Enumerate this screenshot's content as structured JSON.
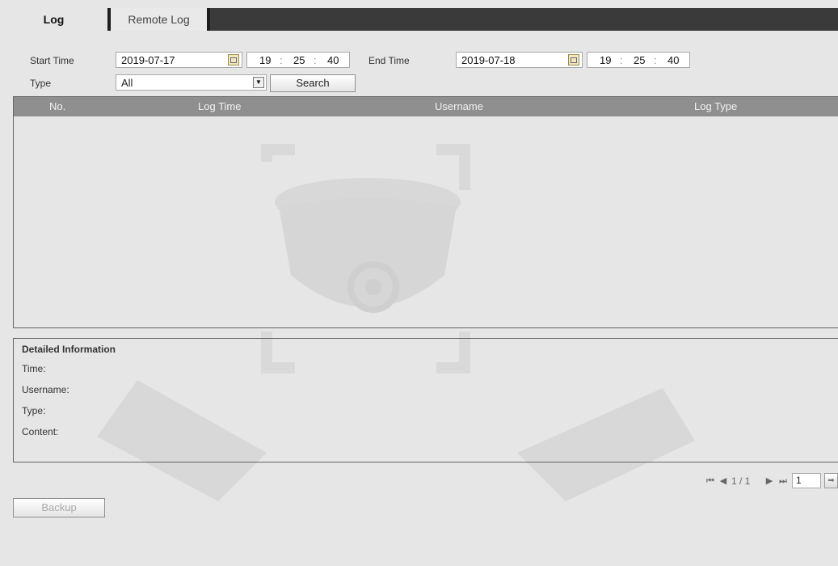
{
  "tabs": [
    {
      "label": "Log",
      "active": true
    },
    {
      "label": "Remote Log",
      "active": false
    }
  ],
  "search": {
    "start_time_label": "Start Time",
    "start_date": "2019-07-17",
    "start_hour": "19",
    "start_min": "25",
    "start_sec": "40",
    "end_time_label": "End Time",
    "end_date": "2019-07-18",
    "end_hour": "19",
    "end_min": "25",
    "end_sec": "40",
    "type_label": "Type",
    "type_value": "All",
    "search_button": "Search"
  },
  "table": {
    "columns": [
      "No.",
      "Log Time",
      "Username",
      "Log Type"
    ],
    "rows": []
  },
  "detail": {
    "title": "Detailed Information",
    "time_label": "Time:",
    "username_label": "Username:",
    "type_label": "Type:",
    "content_label": "Content:"
  },
  "pager": {
    "status": "1 / 1",
    "page_input": "1"
  },
  "backup_button": "Backup",
  "colors": {
    "background": "#e6e6e6",
    "tabbar": "#3a3a3a",
    "grid_header": "#8f8f8f"
  },
  "icons": {
    "calendar": "calendar-icon",
    "dropdown": "chevron-down-icon",
    "first": "first-page-icon",
    "prev": "prev-page-icon",
    "next": "next-page-icon",
    "last": "last-page-icon",
    "go": "go-arrow-icon"
  }
}
